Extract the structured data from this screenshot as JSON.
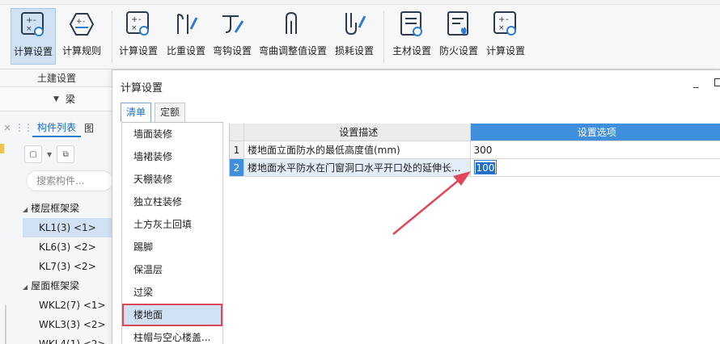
{
  "ribbon": {
    "groups": [
      {
        "label": "土建设置",
        "buttons": [
          {
            "label": "计算设置",
            "icon": "calc-settings-icon",
            "active": true
          },
          {
            "label": "计算规则",
            "icon": "calc-rules-icon",
            "active": false
          }
        ]
      },
      {
        "label": "",
        "buttons": [
          {
            "label": "计算设置",
            "icon": "calc-settings-icon"
          },
          {
            "label": "比重设置",
            "icon": "weight-settings-icon"
          },
          {
            "label": "弯钩设置",
            "icon": "hook-settings-icon"
          },
          {
            "label": "弯曲调整值设置",
            "icon": "bend-adjust-icon"
          },
          {
            "label": "损耗设置",
            "icon": "loss-settings-icon"
          }
        ]
      },
      {
        "label": "",
        "buttons": [
          {
            "label": "主材设置",
            "icon": "main-material-icon"
          },
          {
            "label": "防火设置",
            "icon": "fire-settings-icon"
          },
          {
            "label": "计算设置",
            "icon": "calc-settings-icon"
          }
        ]
      }
    ]
  },
  "left_panel": {
    "dropdown_value": "梁",
    "tabs": [
      "构件列表",
      "图"
    ],
    "search_placeholder": "搜索构件...",
    "tree": [
      {
        "group": "楼层框架梁",
        "items": [
          {
            "label": "KL1(3) <1>",
            "selected": true
          },
          {
            "label": "KL6(3) <2>",
            "selected": false
          },
          {
            "label": "KL7(3) <2>",
            "selected": false
          }
        ]
      },
      {
        "group": "屋面框架梁",
        "items": [
          {
            "label": "WKL2(7) <1>",
            "selected": false
          },
          {
            "label": "WKL3(3) <2>",
            "selected": false
          },
          {
            "label": "WKL4(1) <2>",
            "selected": false
          }
        ]
      }
    ]
  },
  "dialog": {
    "title": "计算设置",
    "tabs": [
      {
        "label": "清单",
        "active": true
      },
      {
        "label": "定额",
        "active": false
      }
    ],
    "categories": [
      "墙面装修",
      "墙裙装修",
      "天棚装修",
      "独立柱装修",
      "土方灰土回填",
      "踢脚",
      "保温层",
      "过梁",
      "楼地面",
      "柱帽与空心楼盖..."
    ],
    "selected_category": "楼地面",
    "table": {
      "headers": [
        "",
        "设置描述",
        "设置选项"
      ],
      "rows": [
        {
          "index": "1",
          "description": "楼地面立面防水的最低高度值(mm)",
          "value": "300",
          "selected": false
        },
        {
          "index": "2",
          "description": "楼地面水平防水在门窗洞口水平开口处的延伸长...",
          "value": "100",
          "selected": true
        }
      ]
    }
  },
  "colors": {
    "accent": "#3f8fdc",
    "annotation": "#e0475a"
  }
}
